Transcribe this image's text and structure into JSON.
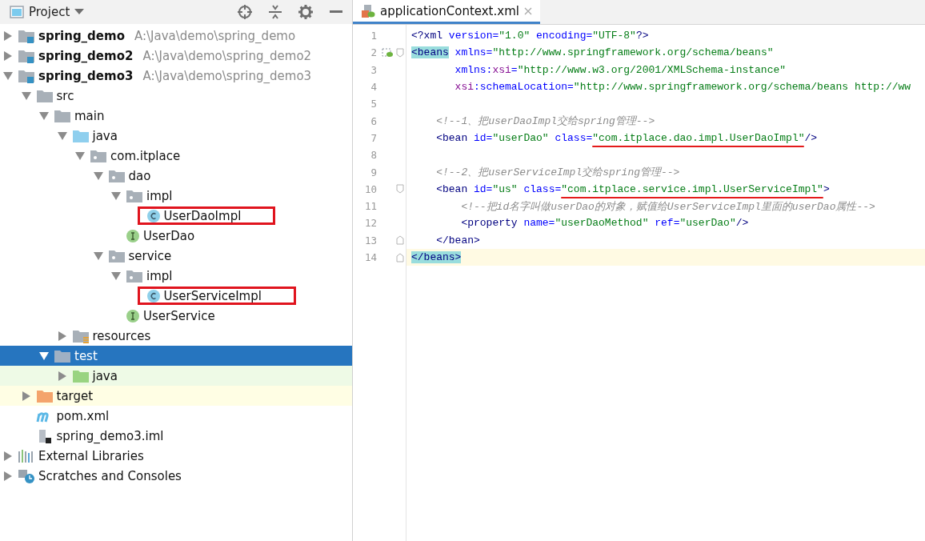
{
  "project_panel": {
    "title": "Project"
  },
  "tree": [
    {
      "kind": "module",
      "label": "spring_demo",
      "path": "A:\\Java\\demo\\spring_demo",
      "expanded": false,
      "selected": false
    },
    {
      "kind": "module",
      "label": "spring_demo2",
      "path": "A:\\Java\\demo\\spring_demo2",
      "expanded": false,
      "selected": false
    },
    {
      "kind": "module",
      "label": "spring_demo3",
      "path": "A:\\Java\\demo\\spring_demo3",
      "expanded": true,
      "selected": false,
      "children": [
        {
          "kind": "folder",
          "label": "src",
          "expanded": true,
          "selected": false,
          "children": [
            {
              "kind": "folder",
              "label": "main",
              "expanded": true,
              "selected": false,
              "children": [
                {
                  "kind": "source",
                  "label": "java",
                  "expanded": true,
                  "selected": false,
                  "children": [
                    {
                      "kind": "package",
                      "label": "com.itplace",
                      "expanded": true,
                      "selected": false,
                      "children": [
                        {
                          "kind": "package",
                          "label": "dao",
                          "expanded": true,
                          "selected": false,
                          "children": [
                            {
                              "kind": "package",
                              "label": "impl",
                              "expanded": true,
                              "selected": false,
                              "children": [
                                {
                                  "kind": "class",
                                  "label": "UserDaoImpl",
                                  "selected": false,
                                  "boxed": true
                                }
                              ]
                            },
                            {
                              "kind": "interface",
                              "label": "UserDao",
                              "selected": false,
                              "boxed": false
                            }
                          ]
                        },
                        {
                          "kind": "package",
                          "label": "service",
                          "expanded": true,
                          "selected": false,
                          "children": [
                            {
                              "kind": "package",
                              "label": "impl",
                              "expanded": true,
                              "selected": false,
                              "children": [
                                {
                                  "kind": "class",
                                  "label": "UserServiceImpl",
                                  "selected": false,
                                  "boxed": true
                                }
                              ]
                            },
                            {
                              "kind": "interface",
                              "label": "UserService",
                              "selected": false,
                              "boxed": false
                            }
                          ]
                        }
                      ]
                    }
                  ]
                },
                {
                  "kind": "resources",
                  "label": "resources",
                  "expanded": false,
                  "selected": false
                }
              ]
            },
            {
              "kind": "test",
              "label": "test",
              "expanded": true,
              "selected": true,
              "children": [
                {
                  "kind": "test-source",
                  "label": "java",
                  "expanded": false,
                  "selected": false
                }
              ]
            }
          ]
        },
        {
          "kind": "excluded",
          "label": "target",
          "expanded": false,
          "selected": false
        },
        {
          "kind": "maven",
          "label": "pom.xml",
          "selected": false
        },
        {
          "kind": "iml",
          "label": "spring_demo3.iml",
          "selected": false
        }
      ]
    },
    {
      "kind": "libraries",
      "label": "External Libraries",
      "expanded": false,
      "selected": false
    },
    {
      "kind": "scratches",
      "label": "Scratches and Consoles",
      "expanded": false,
      "selected": false
    }
  ],
  "editor": {
    "tab": {
      "label": "applicationContext.xml",
      "selected": true
    },
    "lines": [
      {
        "number": "1",
        "kind": "top",
        "current": false,
        "tokens": [
          {
            "kind": "plain",
            "text": "<?"
          },
          {
            "kind": "tag",
            "text": "xml "
          },
          {
            "kind": "attr",
            "text": "version="
          },
          {
            "kind": "value",
            "text": "\"1.0\" "
          },
          {
            "kind": "attr",
            "text": "encoding="
          },
          {
            "kind": "value",
            "text": "\"UTF-8\""
          },
          {
            "kind": "plain",
            "text": "?>"
          }
        ]
      },
      {
        "number": "2",
        "kind": "top",
        "current": false,
        "fold_start": true,
        "bean_icon": true,
        "tokens": [
          {
            "kind": "tag",
            "text": "<beans",
            "matched": true
          },
          {
            "kind": "attr",
            "text": " xmlns="
          },
          {
            "kind": "value",
            "text": "\"http://www.springframework.org/schema/beans\""
          }
        ]
      },
      {
        "number": "3",
        "kind": "continuation",
        "current": false,
        "tokens": [
          {
            "kind": "attr",
            "text": "xmlns:"
          },
          {
            "kind": "ns",
            "text": "xsi"
          },
          {
            "kind": "attr",
            "text": "="
          },
          {
            "kind": "value",
            "text": "\"http://www.w3.org/2001/XMLSchema-instance\""
          }
        ]
      },
      {
        "number": "4",
        "kind": "continuation",
        "current": false,
        "tokens": [
          {
            "kind": "ns",
            "text": "xsi"
          },
          {
            "kind": "attr",
            "text": ":schemaLocation="
          },
          {
            "kind": "value",
            "text": "\"http://www.springframework.org/schema/beans http://ww"
          }
        ]
      },
      {
        "number": "5",
        "kind": "top",
        "current": false
      },
      {
        "number": "6",
        "kind": "nested",
        "current": false,
        "tokens": [
          {
            "kind": "comment",
            "text": "<!--1、把userDaoImpl交给spring管理-->"
          }
        ]
      },
      {
        "number": "7",
        "kind": "nested",
        "current": false,
        "tokens": [
          {
            "kind": "tag",
            "text": "<bean "
          },
          {
            "kind": "attr",
            "text": "id="
          },
          {
            "kind": "value",
            "text": "\"userDao\" "
          },
          {
            "kind": "attr",
            "text": "class="
          },
          {
            "kind": "value",
            "text": "\"com.itplace.dao.impl.UserDaoImpl\"",
            "underlined": true
          },
          {
            "kind": "tag",
            "text": "/>"
          }
        ]
      },
      {
        "number": "8",
        "kind": "top",
        "current": false
      },
      {
        "number": "9",
        "kind": "nested",
        "current": false,
        "tokens": [
          {
            "kind": "comment",
            "text": "<!--2、把userServiceImpl交给spring管理-->"
          }
        ]
      },
      {
        "number": "10",
        "kind": "nested",
        "current": false,
        "fold_start": true,
        "tokens": [
          {
            "kind": "tag",
            "text": "<bean "
          },
          {
            "kind": "attr",
            "text": "id="
          },
          {
            "kind": "value",
            "text": "\"us\" "
          },
          {
            "kind": "attr",
            "text": "class="
          },
          {
            "kind": "value",
            "text": "\"com.itplace.service.impl.UserServiceImpl\"",
            "underlined": true
          },
          {
            "kind": "tag",
            "text": ">"
          }
        ]
      },
      {
        "number": "11",
        "kind": "nested2",
        "current": false,
        "tokens": [
          {
            "kind": "comment",
            "text": "<!--把id名字叫做userDao的对象，赋值给UserServiceImpl里面的userDao属性-->"
          }
        ]
      },
      {
        "number": "12",
        "kind": "nested2",
        "current": false,
        "tokens": [
          {
            "kind": "tag",
            "text": "<property "
          },
          {
            "kind": "attr",
            "text": "name="
          },
          {
            "kind": "value",
            "text": "\"userDaoMethod\" "
          },
          {
            "kind": "attr",
            "text": "ref="
          },
          {
            "kind": "value",
            "text": "\"userDao\""
          },
          {
            "kind": "tag",
            "text": "/>"
          }
        ]
      },
      {
        "number": "13",
        "kind": "nested",
        "current": false,
        "fold_end": true,
        "tokens": [
          {
            "kind": "tag",
            "text": "</bean>"
          }
        ]
      },
      {
        "number": "14",
        "kind": "top",
        "current": true,
        "fold_end": true,
        "tokens": [
          {
            "kind": "tag",
            "text": "</beans>",
            "matched": true
          }
        ]
      }
    ]
  }
}
